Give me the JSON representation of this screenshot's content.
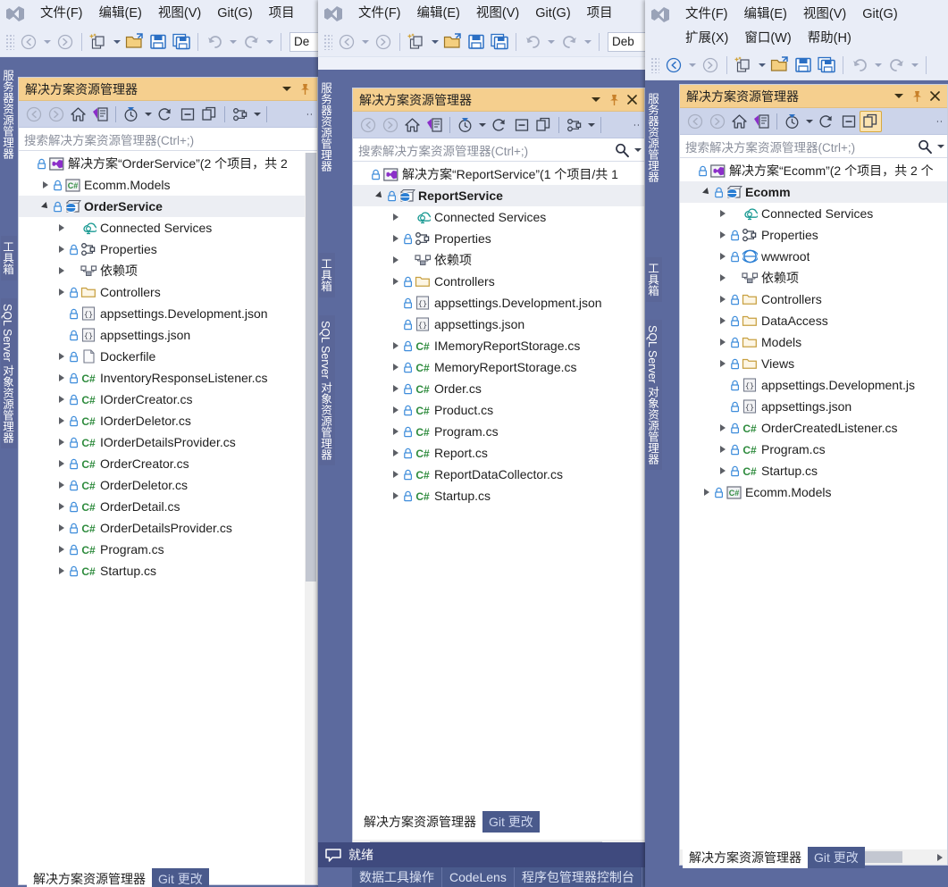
{
  "windows": [
    {
      "id": "orderservice",
      "menu_rows": [
        [
          "文件(F)",
          "编辑(E)",
          "视图(V)",
          "Git(G)",
          "项目"
        ]
      ],
      "toolbar": {
        "config_value": "De"
      },
      "rail_tabs": [
        "服务器资源管理器",
        "工具箱",
        "SQL Server 对象资源管理器"
      ],
      "pane": {
        "title": "解决方案资源管理器",
        "search_placeholder": "搜索解决方案资源管理器(Ctrl+;)",
        "tree": [
          {
            "depth": 0,
            "expander": "none",
            "lock": true,
            "icon": "solution",
            "label": "解决方案“OrderService”(2 个项目，共 2 ",
            "bold": false,
            "selected": false
          },
          {
            "depth": 1,
            "expander": "collapsed",
            "lock": true,
            "icon": "csproj",
            "label": "Ecomm.Models",
            "bold": false,
            "selected": false
          },
          {
            "depth": 1,
            "expander": "expanded",
            "lock": true,
            "icon": "webproj",
            "label": "OrderService",
            "bold": true,
            "selected": true
          },
          {
            "depth": 2,
            "expander": "collapsed",
            "lock": false,
            "icon": "connected",
            "label": "Connected Services",
            "bold": false,
            "selected": false
          },
          {
            "depth": 2,
            "expander": "collapsed",
            "lock": true,
            "icon": "props",
            "label": "Properties",
            "bold": false,
            "selected": false
          },
          {
            "depth": 2,
            "expander": "collapsed",
            "lock": false,
            "icon": "deps",
            "label": "依赖项",
            "bold": false,
            "selected": false
          },
          {
            "depth": 2,
            "expander": "collapsed",
            "lock": true,
            "icon": "folder",
            "label": "Controllers",
            "bold": false,
            "selected": false
          },
          {
            "depth": 2,
            "expander": "none",
            "lock": true,
            "icon": "json",
            "label": "appsettings.Development.json",
            "bold": false,
            "selected": false
          },
          {
            "depth": 2,
            "expander": "none",
            "lock": true,
            "icon": "json",
            "label": "appsettings.json",
            "bold": false,
            "selected": false
          },
          {
            "depth": 2,
            "expander": "collapsed",
            "lock": true,
            "icon": "file",
            "label": "Dockerfile",
            "bold": false,
            "selected": false
          },
          {
            "depth": 2,
            "expander": "collapsed",
            "lock": true,
            "icon": "cs",
            "label": "InventoryResponseListener.cs",
            "bold": false,
            "selected": false
          },
          {
            "depth": 2,
            "expander": "collapsed",
            "lock": true,
            "icon": "cs",
            "label": "IOrderCreator.cs",
            "bold": false,
            "selected": false
          },
          {
            "depth": 2,
            "expander": "collapsed",
            "lock": true,
            "icon": "cs",
            "label": "IOrderDeletor.cs",
            "bold": false,
            "selected": false
          },
          {
            "depth": 2,
            "expander": "collapsed",
            "lock": true,
            "icon": "cs",
            "label": "IOrderDetailsProvider.cs",
            "bold": false,
            "selected": false
          },
          {
            "depth": 2,
            "expander": "collapsed",
            "lock": true,
            "icon": "cs",
            "label": "OrderCreator.cs",
            "bold": false,
            "selected": false
          },
          {
            "depth": 2,
            "expander": "collapsed",
            "lock": true,
            "icon": "cs",
            "label": "OrderDeletor.cs",
            "bold": false,
            "selected": false
          },
          {
            "depth": 2,
            "expander": "collapsed",
            "lock": true,
            "icon": "cs",
            "label": "OrderDetail.cs",
            "bold": false,
            "selected": false
          },
          {
            "depth": 2,
            "expander": "collapsed",
            "lock": true,
            "icon": "cs",
            "label": "OrderDetailsProvider.cs",
            "bold": false,
            "selected": false
          },
          {
            "depth": 2,
            "expander": "collapsed",
            "lock": true,
            "icon": "cs",
            "label": "Program.cs",
            "bold": false,
            "selected": false
          },
          {
            "depth": 2,
            "expander": "collapsed",
            "lock": true,
            "icon": "cs",
            "label": "Startup.cs",
            "bold": false,
            "selected": false
          }
        ]
      },
      "dock_tabs": [
        {
          "label": "解决方案资源管理器",
          "active": true
        },
        {
          "label": "Git 更改",
          "active": false
        }
      ]
    },
    {
      "id": "reportservice",
      "menu_rows": [
        [
          "文件(F)",
          "编辑(E)",
          "视图(V)",
          "Git(G)",
          "项目"
        ]
      ],
      "toolbar": {
        "config_value": "Deb"
      },
      "rail_tabs": [
        "服务器资源管理器",
        "工具箱",
        "SQL Server 对象资源管理器"
      ],
      "pane": {
        "title": "解决方案资源管理器",
        "search_placeholder": "搜索解决方案资源管理器(Ctrl+;)",
        "tree": [
          {
            "depth": 0,
            "expander": "none",
            "lock": true,
            "icon": "solution",
            "label": "解决方案“ReportService”(1 个项目/共 1 ",
            "bold": false,
            "selected": false
          },
          {
            "depth": 1,
            "expander": "expanded",
            "lock": true,
            "icon": "webproj",
            "label": "ReportService",
            "bold": true,
            "selected": true
          },
          {
            "depth": 2,
            "expander": "collapsed",
            "lock": false,
            "icon": "connected",
            "label": "Connected Services",
            "bold": false,
            "selected": false
          },
          {
            "depth": 2,
            "expander": "collapsed",
            "lock": true,
            "icon": "props",
            "label": "Properties",
            "bold": false,
            "selected": false
          },
          {
            "depth": 2,
            "expander": "collapsed",
            "lock": false,
            "icon": "deps",
            "label": "依赖项",
            "bold": false,
            "selected": false
          },
          {
            "depth": 2,
            "expander": "collapsed",
            "lock": true,
            "icon": "folder",
            "label": "Controllers",
            "bold": false,
            "selected": false
          },
          {
            "depth": 2,
            "expander": "none",
            "lock": true,
            "icon": "json",
            "label": "appsettings.Development.json",
            "bold": false,
            "selected": false
          },
          {
            "depth": 2,
            "expander": "none",
            "lock": true,
            "icon": "json",
            "label": "appsettings.json",
            "bold": false,
            "selected": false
          },
          {
            "depth": 2,
            "expander": "collapsed",
            "lock": true,
            "icon": "cs",
            "label": "IMemoryReportStorage.cs",
            "bold": false,
            "selected": false
          },
          {
            "depth": 2,
            "expander": "collapsed",
            "lock": true,
            "icon": "cs",
            "label": "MemoryReportStorage.cs",
            "bold": false,
            "selected": false
          },
          {
            "depth": 2,
            "expander": "collapsed",
            "lock": true,
            "icon": "cs",
            "label": "Order.cs",
            "bold": false,
            "selected": false
          },
          {
            "depth": 2,
            "expander": "collapsed",
            "lock": true,
            "icon": "cs",
            "label": "Product.cs",
            "bold": false,
            "selected": false
          },
          {
            "depth": 2,
            "expander": "collapsed",
            "lock": true,
            "icon": "cs",
            "label": "Program.cs",
            "bold": false,
            "selected": false
          },
          {
            "depth": 2,
            "expander": "collapsed",
            "lock": true,
            "icon": "cs",
            "label": "Report.cs",
            "bold": false,
            "selected": false
          },
          {
            "depth": 2,
            "expander": "collapsed",
            "lock": true,
            "icon": "cs",
            "label": "ReportDataCollector.cs",
            "bold": false,
            "selected": false
          },
          {
            "depth": 2,
            "expander": "collapsed",
            "lock": true,
            "icon": "cs",
            "label": "Startup.cs",
            "bold": false,
            "selected": false
          }
        ]
      },
      "dock_tabs": [
        {
          "label": "解决方案资源管理器",
          "active": true
        },
        {
          "label": "Git 更改",
          "active": false
        }
      ],
      "status": {
        "text": "就绪"
      },
      "output_tabs": [
        "数据工具操作",
        "CodeLens",
        "程序包管理器控制台"
      ]
    },
    {
      "id": "ecomm",
      "menu_rows": [
        [
          "文件(F)",
          "编辑(E)",
          "视图(V)",
          "Git(G)"
        ],
        [
          "扩展(X)",
          "窗口(W)",
          "帮助(H)"
        ]
      ],
      "toolbar": {
        "config_value": ""
      },
      "rail_tabs": [
        "服务器资源管理器",
        "工具箱",
        "SQL Server 对象资源管理器"
      ],
      "pane": {
        "title": "解决方案资源管理器",
        "search_placeholder": "搜索解决方案资源管理器(Ctrl+;)",
        "tree": [
          {
            "depth": 0,
            "expander": "none",
            "lock": true,
            "icon": "solution",
            "label": "解决方案“Ecomm”(2 个项目，共 2 个",
            "bold": false,
            "selected": false
          },
          {
            "depth": 1,
            "expander": "expanded",
            "lock": true,
            "icon": "webproj",
            "label": "Ecomm",
            "bold": true,
            "selected": true
          },
          {
            "depth": 2,
            "expander": "collapsed",
            "lock": false,
            "icon": "connected",
            "label": "Connected Services",
            "bold": false,
            "selected": false
          },
          {
            "depth": 2,
            "expander": "collapsed",
            "lock": true,
            "icon": "props",
            "label": "Properties",
            "bold": false,
            "selected": false
          },
          {
            "depth": 2,
            "expander": "collapsed",
            "lock": true,
            "icon": "www",
            "label": "wwwroot",
            "bold": false,
            "selected": false
          },
          {
            "depth": 2,
            "expander": "collapsed",
            "lock": false,
            "icon": "deps",
            "label": "依赖项",
            "bold": false,
            "selected": false
          },
          {
            "depth": 2,
            "expander": "collapsed",
            "lock": true,
            "icon": "folder",
            "label": "Controllers",
            "bold": false,
            "selected": false
          },
          {
            "depth": 2,
            "expander": "collapsed",
            "lock": true,
            "icon": "folder",
            "label": "DataAccess",
            "bold": false,
            "selected": false
          },
          {
            "depth": 2,
            "expander": "collapsed",
            "lock": true,
            "icon": "folder",
            "label": "Models",
            "bold": false,
            "selected": false
          },
          {
            "depth": 2,
            "expander": "collapsed",
            "lock": true,
            "icon": "folder",
            "label": "Views",
            "bold": false,
            "selected": false
          },
          {
            "depth": 2,
            "expander": "none",
            "lock": true,
            "icon": "json",
            "label": "appsettings.Development.js",
            "bold": false,
            "selected": false
          },
          {
            "depth": 2,
            "expander": "none",
            "lock": true,
            "icon": "json",
            "label": "appsettings.json",
            "bold": false,
            "selected": false
          },
          {
            "depth": 2,
            "expander": "collapsed",
            "lock": true,
            "icon": "cs",
            "label": "OrderCreatedListener.cs",
            "bold": false,
            "selected": false
          },
          {
            "depth": 2,
            "expander": "collapsed",
            "lock": true,
            "icon": "cs",
            "label": "Program.cs",
            "bold": false,
            "selected": false
          },
          {
            "depth": 2,
            "expander": "collapsed",
            "lock": true,
            "icon": "cs",
            "label": "Startup.cs",
            "bold": false,
            "selected": false
          },
          {
            "depth": 1,
            "expander": "collapsed",
            "lock": true,
            "icon": "csproj",
            "label": "Ecomm.Models",
            "bold": false,
            "selected": false
          }
        ]
      },
      "dock_tabs": [
        {
          "label": "解决方案资源管理器",
          "active": true
        },
        {
          "label": "Git 更改",
          "active": false
        }
      ]
    }
  ],
  "icons": {
    "title_dropdown": "chevron-down-icon",
    "title_pin": "pin-icon",
    "title_close": "close-icon",
    "back": "back-arrow-icon",
    "forward": "forward-arrow-icon",
    "home": "home-icon",
    "sync": "sync-with-active-document-icon",
    "pending": "pending-changes-icon",
    "refresh": "refresh-icon",
    "collapse_all": "collapse-all-icon",
    "show_all_files": "show-all-files-icon",
    "properties": "properties-icon",
    "search": "search-icon",
    "new_project": "new-project-icon",
    "open_file": "open-file-icon",
    "save": "save-icon",
    "save_all": "save-all-icon",
    "undo": "undo-icon",
    "redo": "redo-icon",
    "status_notify": "notification-icon"
  },
  "colors": {
    "title_bar": "#f5cf8e",
    "pane_toolbar": "#ccd4ea",
    "window_chrome": "#e9edf7",
    "shell_body": "#5c6a9e",
    "status_bar": "#3f4a7e",
    "active_tab": "#ffffff",
    "inactive_tab": "#4a5a8c",
    "cs_green": "#2e8b3d",
    "folder_gold": "#dca42b",
    "lock_blue": "#3f8ddb"
  }
}
